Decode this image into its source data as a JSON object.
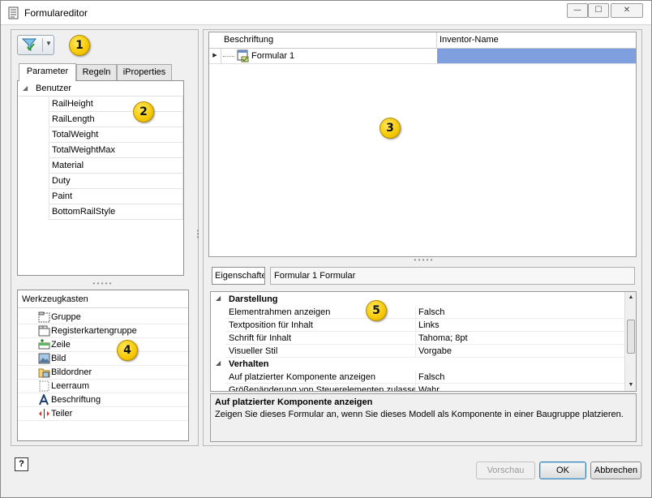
{
  "window": {
    "title": "Formulareditor",
    "controls": {
      "minimize": "—",
      "maximize": "☐",
      "close": "✕"
    }
  },
  "left": {
    "filter_icon": "funnel-filter-icon",
    "tabs": [
      {
        "label": "Parameter",
        "active": true
      },
      {
        "label": "Regeln",
        "active": false
      },
      {
        "label": "iProperties",
        "active": false
      }
    ],
    "tree": {
      "group": "Benutzer",
      "params": [
        "RailHeight",
        "RailLength",
        "TotalWeight",
        "TotalWeightMax",
        "Material",
        "Duty",
        "Paint",
        "BottomRailStyle"
      ]
    },
    "toolbox": {
      "header": "Werkzeugkasten",
      "items": [
        {
          "label": "Gruppe",
          "icon": "group-icon"
        },
        {
          "label": "Registerkartengruppe",
          "icon": "tab-group-icon"
        },
        {
          "label": "Zeile",
          "icon": "row-icon"
        },
        {
          "label": "Bild",
          "icon": "image-icon"
        },
        {
          "label": "Bildordner",
          "icon": "image-folder-icon"
        },
        {
          "label": "Leerraum",
          "icon": "empty-space-icon"
        },
        {
          "label": "Beschriftung",
          "icon": "label-icon"
        },
        {
          "label": "Teiler",
          "icon": "splitter-icon"
        }
      ]
    }
  },
  "right": {
    "grid": {
      "columns": [
        "Beschriftung",
        "Inventor-Name"
      ],
      "rows": [
        {
          "label": "Formular 1",
          "inventor_name": ""
        }
      ]
    },
    "properties": {
      "tab_label": "Eigenschaften",
      "title": "Formular 1 Formular",
      "categories": [
        {
          "name": "Darstellung",
          "rows": [
            {
              "key": "Elementrahmen anzeigen",
              "value": "Falsch"
            },
            {
              "key": "Textposition für Inhalt",
              "value": "Links"
            },
            {
              "key": "Schrift für Inhalt",
              "value": "Tahoma; 8pt"
            },
            {
              "key": "Visueller Stil",
              "value": "Vorgabe"
            }
          ]
        },
        {
          "name": "Verhalten",
          "rows": [
            {
              "key": "Auf platzierter Komponente anzeigen",
              "value": "Falsch"
            },
            {
              "key": "Größenänderung von Steuerelementen zulasse",
              "value": "Wahr"
            }
          ]
        }
      ]
    },
    "description": {
      "title": "Auf platzierter Komponente anzeigen",
      "body": "Zeigen Sie dieses Formular an, wenn Sie dieses Modell als Komponente in einer Baugruppe platzieren."
    }
  },
  "footer": {
    "help": "?",
    "preview": "Vorschau",
    "ok": "OK",
    "cancel": "Abbrechen"
  },
  "callouts": [
    "1",
    "2",
    "3",
    "4",
    "5"
  ],
  "colors": {
    "selection": "#7f9fdf",
    "callout": "#f6c800"
  }
}
